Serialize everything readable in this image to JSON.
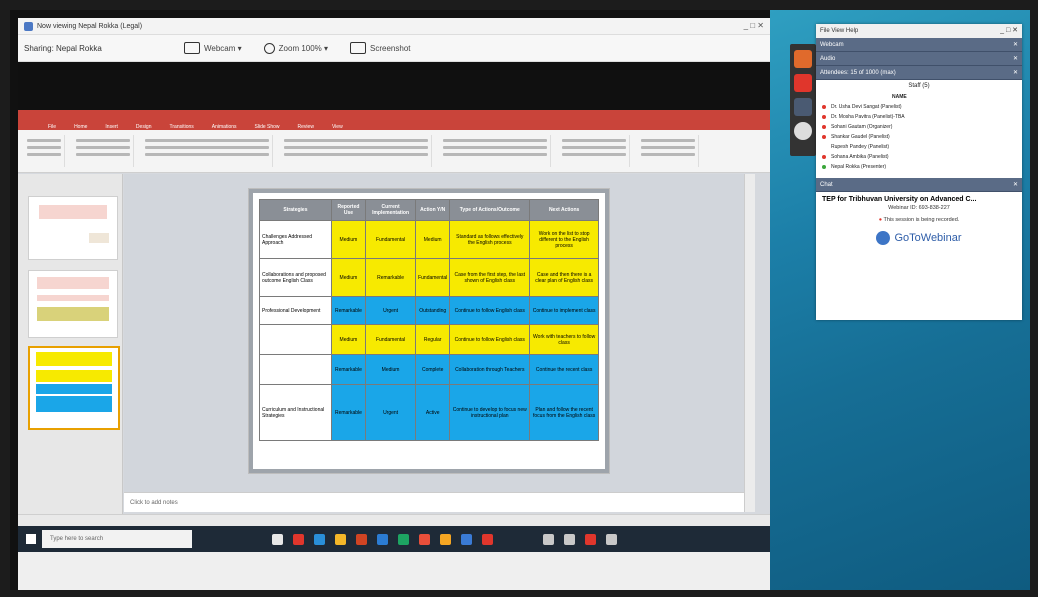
{
  "viewer": {
    "title": "Now viewing Nepal Rokka (Legal)",
    "presenter": "Sharing: Nepal Rokka",
    "webcam": "Webcam ▾",
    "zoom": "Zoom 100% ▾",
    "screenshot": "Screenshot",
    "window_btns": "_ □ ✕"
  },
  "ppt": {
    "tabs": [
      "File",
      "Home",
      "Insert",
      "Design",
      "Transitions",
      "Animations",
      "Slide Show",
      "Review",
      "View"
    ],
    "notes": "Click to add notes",
    "search": "Type here to search"
  },
  "slide_table": {
    "headers": [
      "Strategies",
      "Reported Use",
      "Current Implementation",
      "Action Y/N",
      "Type of Actions/Outcome",
      "Next Actions"
    ],
    "rows": [
      {
        "label": "Challenges Addressed Approach",
        "color": "y",
        "cells": [
          "Medium",
          "Fundamental",
          "Medium",
          "Standard as follows effectively the English process",
          "Work on the list to stop different to the English process"
        ]
      },
      {
        "label": "Collaborations and proposed outcome English Class",
        "color": "y",
        "cells": [
          "Medium",
          "Remarkable",
          "Fundamental",
          "Case from the first step, the last shown of English class",
          "Case and then there is a clear plan of English class"
        ]
      },
      {
        "label": "Professional Development",
        "color": "b",
        "cells": [
          "Remarkable",
          "Urgent",
          "Outstanding",
          "Continue to follow English class",
          "Continue to implement class"
        ]
      },
      {
        "label": "",
        "color": "y",
        "cells": [
          "Medium",
          "Fundamental",
          "Regular",
          "Continue to follow English class",
          "Work with teachers to follow class"
        ]
      },
      {
        "label": "",
        "color": "b",
        "cells": [
          "Remarkable",
          "Medium",
          "Complete",
          "Collaboration through Teachers",
          "Continue the recent class"
        ]
      },
      {
        "label": "Curriculum and Instructional Strategies",
        "color": "b",
        "cells": [
          "Remarkable",
          "Urgent",
          "Active",
          "Continue to develop to focus new instructional plan",
          "Plan and follow the recent focus from the English class"
        ]
      }
    ]
  },
  "gtw": {
    "menu": "File  View  Help",
    "panes": [
      "Webcam",
      "Audio",
      "Attendees: 15 of 1000 (max)"
    ],
    "staff_count": "Staff (5)",
    "col_header": "NAME",
    "attendees": [
      {
        "name": "Dr. Usha Devi Sangat (Panelist)",
        "color": "#e0362c"
      },
      {
        "name": "Dr. Mosha Pavitra (Panelist)-TBA",
        "color": "#e0362c"
      },
      {
        "name": "Sohani Gautam (Organizer)",
        "color": "#e0362c"
      },
      {
        "name": "Shankar Gaudel (Panelist)",
        "color": "#e0362c"
      },
      {
        "name": "Rupesh Pandey (Panelist)",
        "color": "#ffffff"
      },
      {
        "name": "Sohana Ambika (Panelist)",
        "color": "#e0362c"
      },
      {
        "name": "Nepal Rokka (Presenter)",
        "color": "#3aa63a"
      }
    ],
    "chat_label": "Chat",
    "webinar_title": "TEP for Tribhuvan University on Advanced C...",
    "webinar_id": "Webinar ID: 693-838-227",
    "recording": "This session is being recorded.",
    "brand": "GoToWebinar"
  }
}
